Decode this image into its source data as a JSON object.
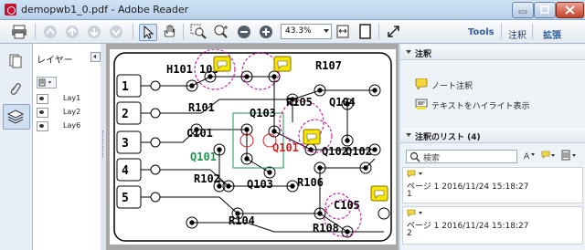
{
  "window": {
    "title": "demopwb1_0.pdf - Adobe Reader"
  },
  "toolbar": {
    "zoom": "43.3%",
    "tools_label": "Tools",
    "comment_label": "注釈",
    "extend_label": "拡張"
  },
  "layers_panel": {
    "title": "レイヤー",
    "items": [
      {
        "label": "Lay1"
      },
      {
        "label": "Lay2"
      },
      {
        "label": "Lay6"
      }
    ]
  },
  "comments_panel": {
    "section_title": "注釈",
    "tools": [
      {
        "label": "ノート注釈",
        "icon": "note-icon"
      },
      {
        "label": "テキストをハイライト表示",
        "icon": "highlight-text-icon"
      }
    ],
    "list_title": "注釈のリスト (4)",
    "search_placeholder": "検索",
    "entries": [
      {
        "meta": "ページ 1  2016/11/24 15:18:27",
        "text": "1"
      },
      {
        "meta": "ページ 1  2016/11/24 15:18:27",
        "text": "2"
      }
    ]
  },
  "pcb": {
    "labels": [
      "H101",
      "105",
      "R107",
      "R105",
      "Q104",
      "R101",
      "Q103",
      "C101",
      "Q102",
      "Q101",
      "Q101",
      "Q102",
      "R102",
      "Q103",
      "R106",
      "C105",
      "R104",
      "R108"
    ],
    "pins": [
      "1",
      "2",
      "3",
      "4",
      "5"
    ],
    "colors": {
      "trace": "#000000",
      "highlight": "#c2008a",
      "note": "#f7e600",
      "green": "#1a9a4a",
      "red": "#d62020"
    }
  }
}
